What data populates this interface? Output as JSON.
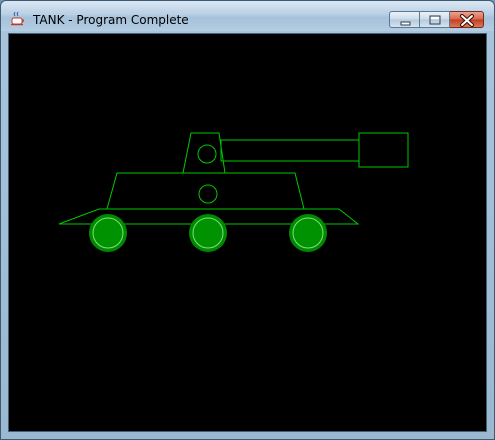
{
  "window": {
    "title": "TANK - Program Complete"
  },
  "icons": {
    "app": "java-cup-icon",
    "minimize": "minimize-icon",
    "maximize": "maximize-icon",
    "close": "close-icon"
  },
  "colors": {
    "canvas_background": "#000000",
    "outline": "#00c800",
    "wheel_fill": "#008a00",
    "close_button": "#c7432a"
  }
}
